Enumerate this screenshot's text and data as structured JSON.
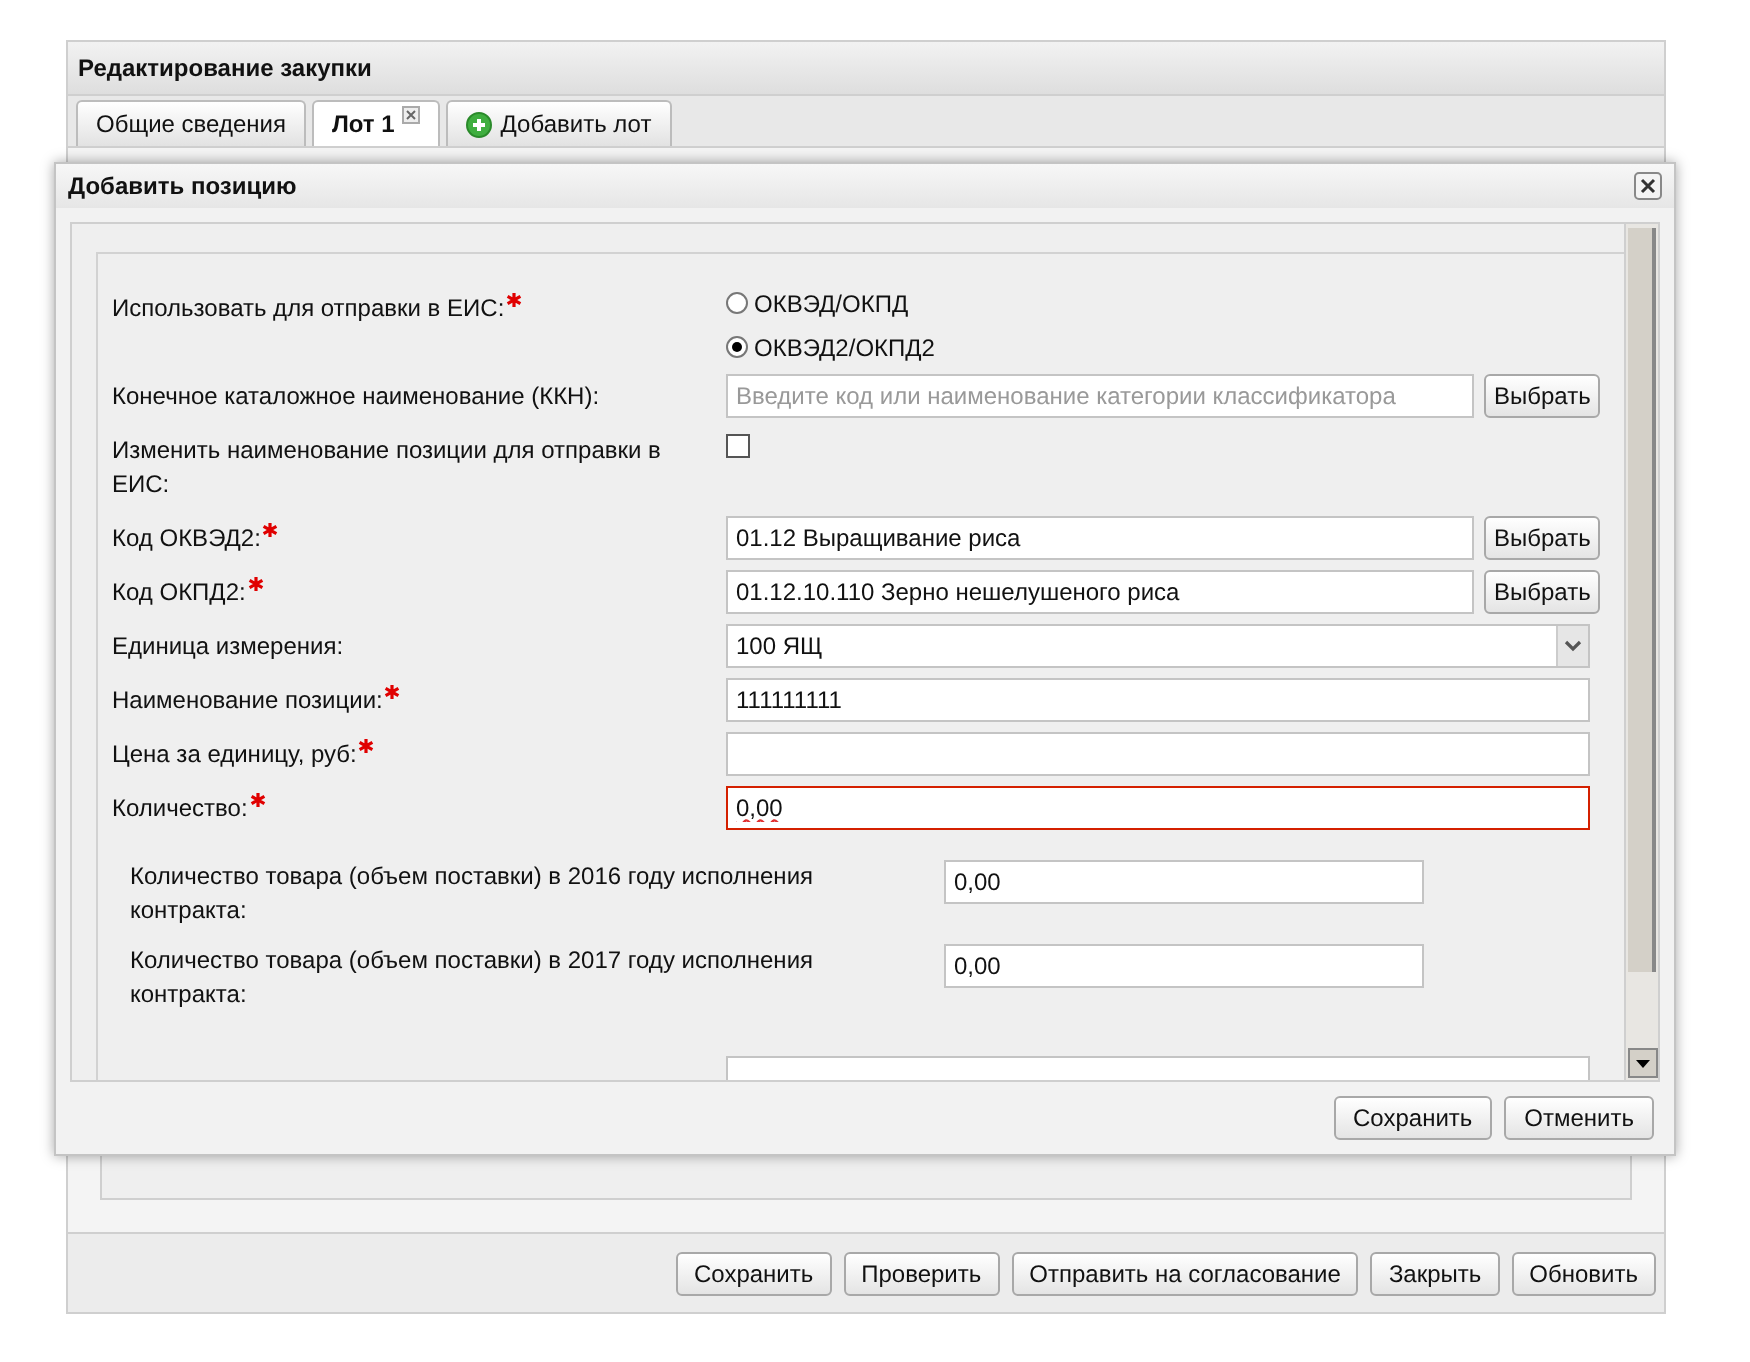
{
  "page": {
    "title": "Редактирование закупки",
    "tabs": [
      {
        "label": "Общие сведения",
        "selected": false,
        "kind": "plain"
      },
      {
        "label": "Лот 1",
        "selected": true,
        "kind": "closable"
      },
      {
        "label": "Добавить лот",
        "selected": false,
        "kind": "add"
      }
    ],
    "toolbar_buttons": [
      "Сохранить",
      "Проверить",
      "Отправить на согласование",
      "Закрыть",
      "Обновить"
    ]
  },
  "dialog": {
    "title": "Добавить позицию",
    "fields": [
      {
        "kind": "radio",
        "label": "Использовать для отправки в ЕИС:",
        "required": true,
        "options": [
          {
            "label": "ОКВЭД/ОКПД",
            "selected": false
          },
          {
            "label": "ОКВЭД2/ОКПД2",
            "selected": true
          }
        ]
      },
      {
        "kind": "lookup",
        "label": "Конечное каталожное наименование (ККН):",
        "required": false,
        "placeholder": "Введите код или наименование категории классификатора",
        "button": "Выбрать"
      },
      {
        "kind": "checkbox",
        "label": "Изменить наименование позиции для отправки в ЕИС:",
        "required": false,
        "checked": false
      },
      {
        "kind": "lookup",
        "label": "Код ОКВЭД2:",
        "required": true,
        "value": "01.12 Выращивание риса",
        "button": "Выбрать"
      },
      {
        "kind": "lookup",
        "label": "Код ОКПД2:",
        "required": true,
        "value": "01.12.10.110 Зерно нешелушеного риса",
        "button": "Выбрать"
      },
      {
        "kind": "select",
        "label": "Единица измерения:",
        "required": false,
        "value": "100 ЯЩ"
      },
      {
        "kind": "text",
        "label": "Наименование позиции:",
        "required": true,
        "value": "111111111",
        "invalid": false
      },
      {
        "kind": "text",
        "label": "Цена за единицу, руб:",
        "required": true,
        "invalid": false
      },
      {
        "kind": "text",
        "label": "Количество:",
        "required": true,
        "value": "0,00",
        "invalid": true
      }
    ],
    "quantity_breakdown": [
      {
        "label": "Количество товара (объем поставки) в 2016 году исполнения контракта:",
        "value": "0,00"
      },
      {
        "label": "Количество товара (объем поставки) в 2017 году исполнения контракта:",
        "value": "0,00"
      }
    ],
    "buttons": [
      "Сохранить",
      "Отменить"
    ]
  }
}
